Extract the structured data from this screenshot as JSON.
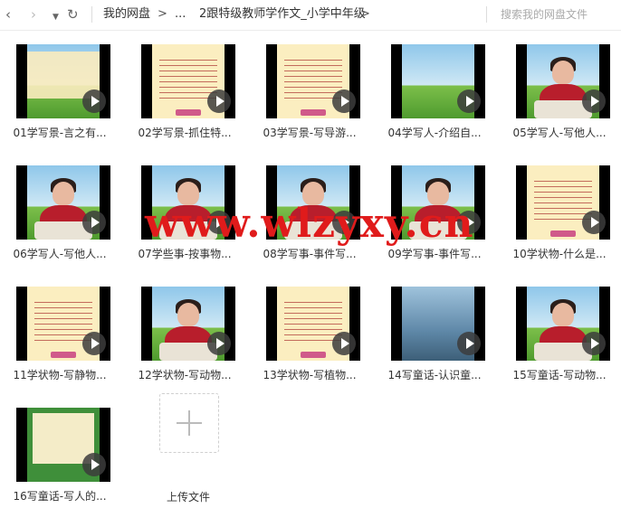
{
  "toolbar": {
    "back_icon": "chevron-left-icon",
    "forward_icon": "chevron-right-icon",
    "dropdown_icon": "caret-down-icon",
    "refresh_icon": "refresh-icon",
    "breadcrumb": [
      "我的网盘",
      "...",
      "2跟特级教师学作文_小学中年级"
    ],
    "separator": ">",
    "search_placeholder": "搜索我的网盘文件"
  },
  "files": [
    {
      "name": "01学写景-言之有...",
      "thumb": "slide"
    },
    {
      "name": "02学写景-抓住特...",
      "thumb": "paper"
    },
    {
      "name": "03学写景-写导游...",
      "thumb": "paper"
    },
    {
      "name": "04学写人-介绍自...",
      "thumb": "landscape"
    },
    {
      "name": "05学写人-写他人...",
      "thumb": "teacher"
    },
    {
      "name": "06学写人-写他人...",
      "thumb": "teacher"
    },
    {
      "name": "07学些事-按事物...",
      "thumb": "teacher"
    },
    {
      "name": "08学写事-事件写...",
      "thumb": "teacher"
    },
    {
      "name": "09学写事-事件写...",
      "thumb": "teacher"
    },
    {
      "name": "10学状物-什么是...",
      "thumb": "paper"
    },
    {
      "name": "11学状物-写静物...",
      "thumb": "paper"
    },
    {
      "name": "12学状物-写动物...",
      "thumb": "teacher"
    },
    {
      "name": "13学状物-写植物...",
      "thumb": "paper"
    },
    {
      "name": "14写童话-认识童...",
      "thumb": "photo"
    },
    {
      "name": "15写童话-写动物...",
      "thumb": "teacher"
    },
    {
      "name": "16写童话-写人的...",
      "thumb": "board"
    }
  ],
  "upload": {
    "label": "上传文件",
    "icon": "plus-icon"
  },
  "watermark": "www.wlzyxy.cn",
  "colors": {
    "watermark": "#e01b1b",
    "coat": "#b81e2c"
  }
}
